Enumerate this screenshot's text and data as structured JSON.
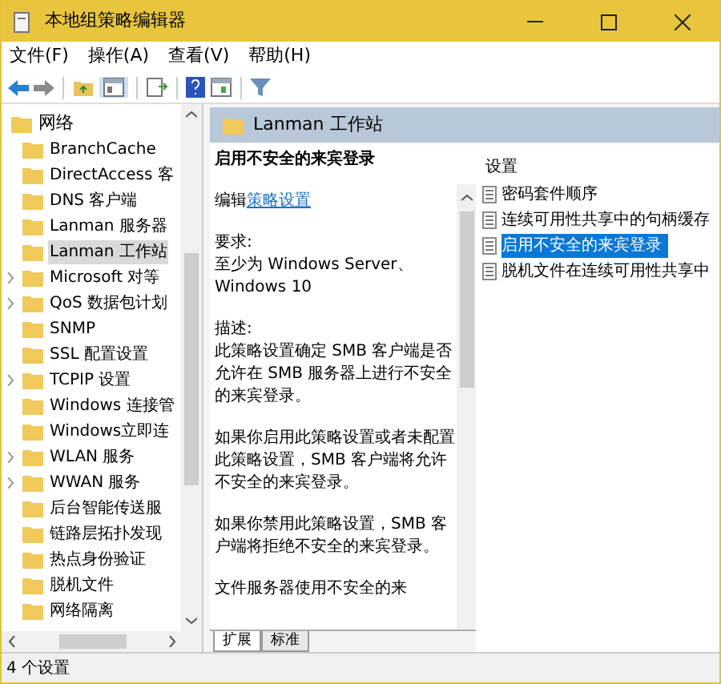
{
  "window": {
    "title": "本地组策略编辑器"
  },
  "menu": [
    "文件(F)",
    "操作(A)",
    "查看(V)",
    "帮助(H)"
  ],
  "tree": {
    "label": "网络",
    "children": [
      {
        "label": "BranchCache",
        "has_children": false,
        "selected": false
      },
      {
        "label": "DirectAccess 客",
        "has_children": false,
        "selected": false
      },
      {
        "label": "DNS 客户端",
        "has_children": false,
        "selected": false
      },
      {
        "label": "Lanman 服务器",
        "has_children": false,
        "selected": false
      },
      {
        "label": "Lanman 工作站",
        "has_children": false,
        "selected": true
      },
      {
        "label": "Microsoft 对等",
        "has_children": true,
        "selected": false
      },
      {
        "label": "QoS 数据包计划",
        "has_children": true,
        "selected": false
      },
      {
        "label": "SNMP",
        "has_children": false,
        "selected": false
      },
      {
        "label": "SSL 配置设置",
        "has_children": false,
        "selected": false
      },
      {
        "label": "TCPIP 设置",
        "has_children": true,
        "selected": false
      },
      {
        "label": "Windows 连接管",
        "has_children": false,
        "selected": false
      },
      {
        "label": "Windows立即连",
        "has_children": false,
        "selected": false
      },
      {
        "label": "WLAN 服务",
        "has_children": true,
        "selected": false
      },
      {
        "label": "WWAN 服务",
        "has_children": true,
        "selected": false
      },
      {
        "label": "后台智能传送服",
        "has_children": false,
        "selected": false
      },
      {
        "label": "链路层拓扑发现",
        "has_children": false,
        "selected": false
      },
      {
        "label": "热点身份验证",
        "has_children": false,
        "selected": false
      },
      {
        "label": "脱机文件",
        "has_children": false,
        "selected": false
      },
      {
        "label": "网络隔离",
        "has_children": false,
        "selected": false
      }
    ]
  },
  "header": {
    "title": "Lanman 工作站"
  },
  "description": {
    "title": "启用不安全的来宾登录",
    "edit_prefix": "编辑",
    "edit_link": "策略设置",
    "requirements_label": "要求:",
    "requirements": "至少为 Windows Server、Windows 10",
    "description_label": "描述:",
    "paragraphs": [
      "此策略设置确定 SMB 客户端是否允许在 SMB 服务器上进行不安全的来宾登录。",
      "如果你启用此策略设置或者未配置此策略设置，SMB 客户端将允许不安全的来宾登录。",
      "如果你禁用此策略设置，SMB 客户端将拒绝不安全的来宾登录。",
      "文件服务器使用不安全的来"
    ]
  },
  "settings": {
    "column": "设置",
    "items": [
      {
        "label": "密码套件顺序",
        "selected": false
      },
      {
        "label": "连续可用性共享中的句柄缓存",
        "selected": false
      },
      {
        "label": "启用不安全的来宾登录",
        "selected": true
      },
      {
        "label": "脱机文件在连续可用性共享中",
        "selected": false
      }
    ]
  },
  "tabs": [
    {
      "label": "扩展",
      "selected": true
    },
    {
      "label": "标准",
      "selected": false
    }
  ],
  "status_bar": "4 个设置"
}
